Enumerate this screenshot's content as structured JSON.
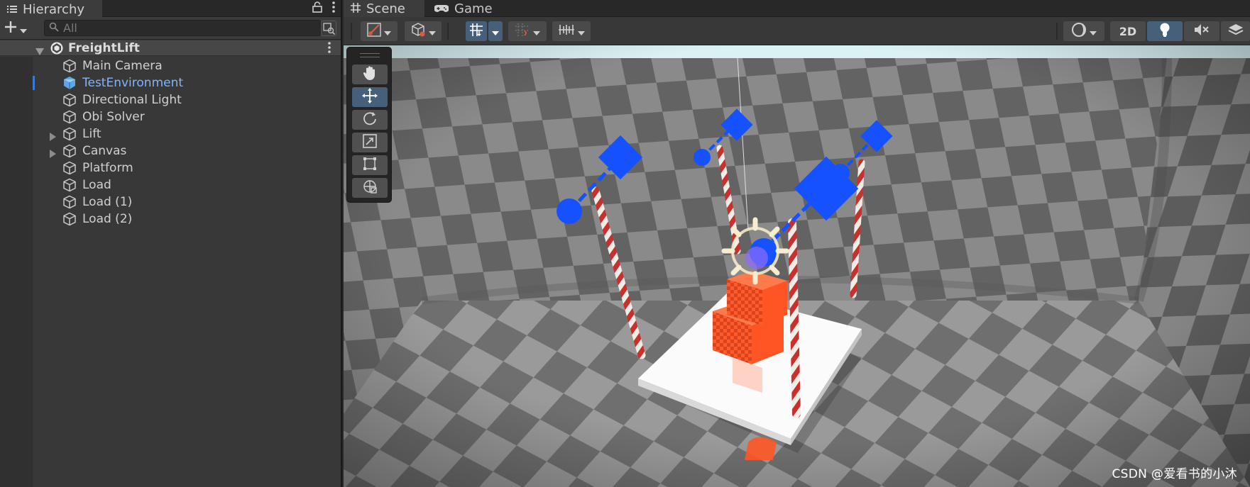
{
  "hierarchy": {
    "tab_label": "Hierarchy",
    "search_placeholder": "All",
    "scene_name": "FreightLift",
    "items": [
      {
        "label": "Main Camera",
        "expandable": false,
        "selected": false
      },
      {
        "label": "TestEnvironment",
        "expandable": false,
        "selected": true
      },
      {
        "label": "Directional Light",
        "expandable": false,
        "selected": false
      },
      {
        "label": "Obi Solver",
        "expandable": false,
        "selected": false
      },
      {
        "label": "Lift",
        "expandable": true,
        "selected": false
      },
      {
        "label": "Canvas",
        "expandable": true,
        "selected": false
      },
      {
        "label": "Platform",
        "expandable": false,
        "selected": false
      },
      {
        "label": "Load",
        "expandable": false,
        "selected": false
      },
      {
        "label": "Load (1)",
        "expandable": false,
        "selected": false
      },
      {
        "label": "Load (2)",
        "expandable": false,
        "selected": false
      }
    ]
  },
  "scene_view": {
    "tabs": [
      {
        "label": "Scene",
        "icon": "grid-icon",
        "active": true
      },
      {
        "label": "Game",
        "icon": "gamepad-icon",
        "active": false
      }
    ],
    "toolbar": {
      "two_d_label": "2D",
      "lighting_on": true
    },
    "tools": [
      "hand-tool",
      "move-tool",
      "rotate-tool",
      "scale-tool",
      "rect-tool",
      "transform-tool"
    ],
    "active_tool": "move-tool"
  },
  "watermark": "CSDN @爱看书的小沐",
  "colors": {
    "accent_blue": "#1651ff",
    "selection_text": "#7fb4ff",
    "active_button": "#46607c",
    "rope_red": "#d42a2a",
    "load_orange": "#ff4d1f"
  }
}
